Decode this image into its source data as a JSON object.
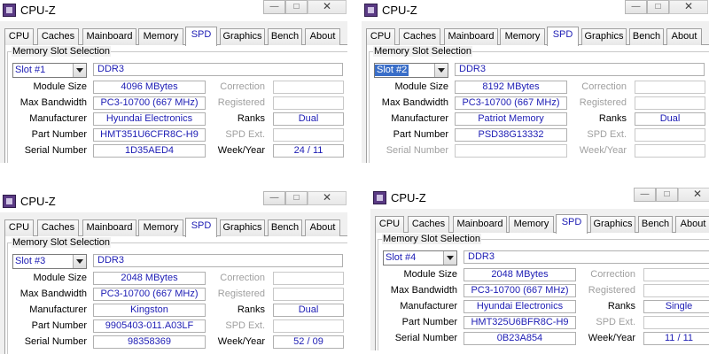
{
  "windows": [
    {
      "title": "CPU-Z",
      "minimize": "—",
      "maximize": "□",
      "close": "✕",
      "tabs": [
        "CPU",
        "Caches",
        "Mainboard",
        "Memory",
        "SPD",
        "Graphics",
        "Bench",
        "About"
      ],
      "active_tab": "SPD",
      "group_label": "Memory Slot Selection",
      "slot": "Slot #1",
      "slot_selected": false,
      "memory_type": "DDR3",
      "labels": {
        "module_size": "Module Size",
        "max_bandwidth": "Max Bandwidth",
        "manufacturer": "Manufacturer",
        "part_number": "Part Number",
        "serial_number": "Serial Number",
        "correction": "Correction",
        "registered": "Registered",
        "ranks": "Ranks",
        "spd_ext": "SPD Ext.",
        "week_year": "Week/Year"
      },
      "values": {
        "module_size": "4096 MBytes",
        "max_bandwidth": "PC3-10700 (667 MHz)",
        "manufacturer": "Hyundai Electronics",
        "part_number": "HMT351U6CFR8C-H9",
        "serial_number": "1D35AED4",
        "correction": "",
        "registered": "",
        "ranks": "Dual",
        "spd_ext": "",
        "week_year": "24 / 11"
      }
    },
    {
      "title": "CPU-Z",
      "minimize": "—",
      "maximize": "□",
      "close": "✕",
      "tabs": [
        "CPU",
        "Caches",
        "Mainboard",
        "Memory",
        "SPD",
        "Graphics",
        "Bench",
        "About"
      ],
      "active_tab": "SPD",
      "group_label": "Memory Slot Selection",
      "slot": "Slot #2",
      "slot_selected": true,
      "memory_type": "DDR3",
      "labels": {
        "module_size": "Module Size",
        "max_bandwidth": "Max Bandwidth",
        "manufacturer": "Manufacturer",
        "part_number": "Part Number",
        "serial_number": "Serial Number",
        "correction": "Correction",
        "registered": "Registered",
        "ranks": "Ranks",
        "spd_ext": "SPD Ext.",
        "week_year": "Week/Year"
      },
      "values": {
        "module_size": "8192 MBytes",
        "max_bandwidth": "PC3-10700 (667 MHz)",
        "manufacturer": "Patriot Memory",
        "part_number": "PSD38G13332",
        "serial_number": "",
        "correction": "",
        "registered": "",
        "ranks": "Dual",
        "spd_ext": "",
        "week_year": ""
      }
    },
    {
      "title": "CPU-Z",
      "minimize": "—",
      "maximize": "□",
      "close": "✕",
      "tabs": [
        "CPU",
        "Caches",
        "Mainboard",
        "Memory",
        "SPD",
        "Graphics",
        "Bench",
        "About"
      ],
      "active_tab": "SPD",
      "group_label": "Memory Slot Selection",
      "slot": "Slot #3",
      "slot_selected": false,
      "memory_type": "DDR3",
      "labels": {
        "module_size": "Module Size",
        "max_bandwidth": "Max Bandwidth",
        "manufacturer": "Manufacturer",
        "part_number": "Part Number",
        "serial_number": "Serial Number",
        "correction": "Correction",
        "registered": "Registered",
        "ranks": "Ranks",
        "spd_ext": "SPD Ext.",
        "week_year": "Week/Year"
      },
      "values": {
        "module_size": "2048 MBytes",
        "max_bandwidth": "PC3-10700 (667 MHz)",
        "manufacturer": "Kingston",
        "part_number": "9905403-011.A03LF",
        "serial_number": "98358369",
        "correction": "",
        "registered": "",
        "ranks": "Dual",
        "spd_ext": "",
        "week_year": "52 / 09"
      }
    },
    {
      "title": "CPU-Z",
      "minimize": "—",
      "maximize": "□",
      "close": "✕",
      "tabs": [
        "CPU",
        "Caches",
        "Mainboard",
        "Memory",
        "SPD",
        "Graphics",
        "Bench",
        "About"
      ],
      "active_tab": "SPD",
      "group_label": "Memory Slot Selection",
      "slot": "Slot #4",
      "slot_selected": false,
      "memory_type": "DDR3",
      "labels": {
        "module_size": "Module Size",
        "max_bandwidth": "Max Bandwidth",
        "manufacturer": "Manufacturer",
        "part_number": "Part Number",
        "serial_number": "Serial Number",
        "correction": "Correction",
        "registered": "Registered",
        "ranks": "Ranks",
        "spd_ext": "SPD Ext.",
        "week_year": "Week/Year"
      },
      "values": {
        "module_size": "2048 MBytes",
        "max_bandwidth": "PC3-10700 (667 MHz)",
        "manufacturer": "Hyundai Electronics",
        "part_number": "HMT325U6BFR8C-H9",
        "serial_number": "0B23A854",
        "correction": "",
        "registered": "",
        "ranks": "Single",
        "spd_ext": "",
        "week_year": "11 / 11"
      }
    }
  ],
  "colors": {
    "value_text": "#1c1cb4",
    "window_bg": "#f0f0f0",
    "dim_label": "#a0a0a0",
    "slot_highlight": "#3a6ec8"
  }
}
